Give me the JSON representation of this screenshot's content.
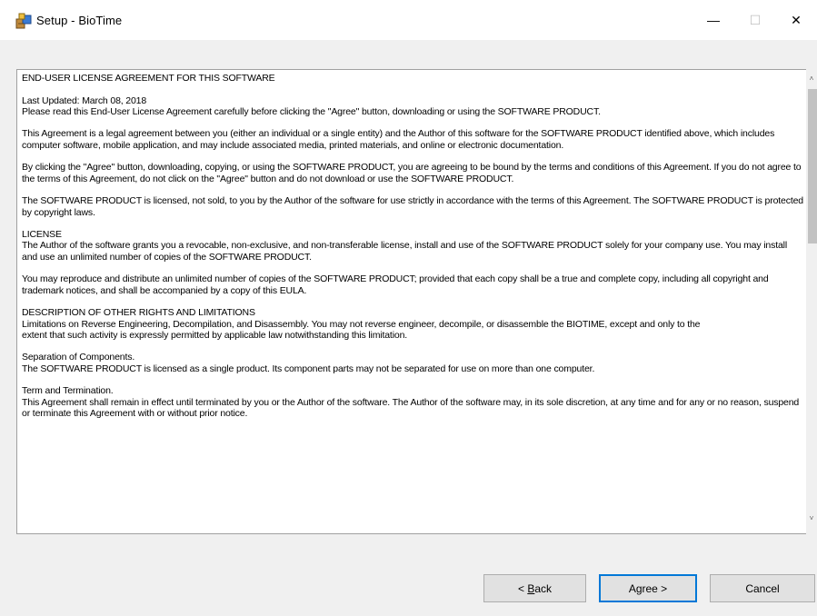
{
  "window": {
    "title": "Setup - BioTime",
    "minimize_glyph": "—",
    "maximize_glyph": "☐",
    "close_glyph": "✕"
  },
  "license": {
    "paragraphs": [
      "END-USER LICENSE AGREEMENT FOR THIS SOFTWARE",
      "Last Updated: March 08, 2018\nPlease read this End-User License Agreement carefully before clicking the \"Agree\" button, downloading or using the SOFTWARE PRODUCT.",
      "This Agreement is a legal agreement between you (either an individual or a single entity) and the Author of this software for the SOFTWARE PRODUCT identified above, which includes computer software, mobile application, and may include associated media, printed materials, and online or electronic documentation.",
      "By clicking the \"Agree\" button, downloading, copying, or using the SOFTWARE PRODUCT, you are agreeing to be bound by the terms and conditions of this Agreement. If you do not agree to the terms of this Agreement, do not click on the \"Agree\" button and do not download or use the SOFTWARE PRODUCT.",
      "The SOFTWARE PRODUCT is licensed, not sold, to you by the Author of the software for use strictly in accordance with the terms of this Agreement. The SOFTWARE PRODUCT is protected by copyright laws.",
      "LICENSE\nThe Author of the software grants you a revocable, non-exclusive, and non-transferable license,  install and use of the SOFTWARE PRODUCT solely for your company use. You may install and use an unlimited number of copies of the SOFTWARE PRODUCT.",
      "You may reproduce and distribute an unlimited number of copies of the SOFTWARE PRODUCT; provided that each copy shall be a true and complete copy, including all copyright and trademark notices, and shall be accompanied by a copy of this EULA.",
      "DESCRIPTION OF OTHER RIGHTS AND LIMITATIONS\nLimitations on Reverse Engineering, Decompilation, and Disassembly. You may not reverse engineer, decompile, or disassemble the BIOTIME, except and only to the\nextent that such activity is expressly permitted by applicable law notwithstanding this limitation.",
      "Separation of Components.\nThe SOFTWARE PRODUCT is licensed as a single product. Its component parts may not be separated for use on more than one computer.",
      "Term and Termination.\nThis Agreement shall remain in effect until terminated by you or the Author of the software. The Author of the software may, in its sole discretion, at any time and for any or no reason, suspend or terminate this Agreement with or without prior notice."
    ]
  },
  "scrollbar": {
    "up_glyph": "˄",
    "down_glyph": "˅",
    "position_fraction": 0.0
  },
  "buttons": {
    "back_prefix": "< ",
    "back_accel": "B",
    "back_rest": "ack",
    "agree": "Agree >",
    "cancel": "Cancel"
  },
  "icons": {
    "app": "setup-box-icon"
  }
}
